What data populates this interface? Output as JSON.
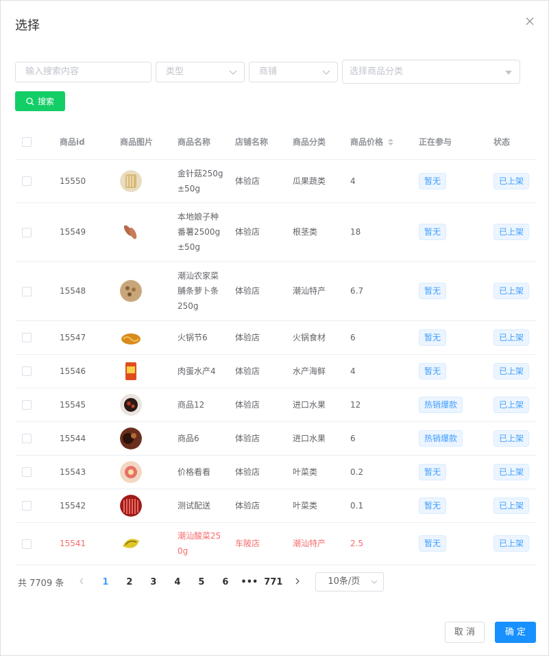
{
  "dialog": {
    "title": "选择"
  },
  "filters": {
    "search_placeholder": "输入搜索内容",
    "type_placeholder": "类型",
    "shop_placeholder": "商铺",
    "category_placeholder": "选择商品分类",
    "search_label": "搜索"
  },
  "table": {
    "headers": [
      "商品id",
      "商品图片",
      "商品名称",
      "店铺名称",
      "商品分类",
      "商品价格",
      "正在参与",
      "状态"
    ],
    "rows": [
      {
        "id": "15550",
        "name": "金针菇250g±50g",
        "shop": "体验店",
        "category": "瓜果蔬类",
        "price": "4",
        "participating": "暂无",
        "status": "已上架"
      },
      {
        "id": "15549",
        "name": "本地娘子种番薯2500g±50g",
        "shop": "体验店",
        "category": "根茎类",
        "price": "18",
        "participating": "暂无",
        "status": "已上架"
      },
      {
        "id": "15548",
        "name": "潮汕农家菜脯条萝卜条250g",
        "shop": "体验店",
        "category": "潮汕特产",
        "price": "6.7",
        "participating": "暂无",
        "status": "已上架"
      },
      {
        "id": "15547",
        "name": "火锅节6",
        "shop": "体验店",
        "category": "火锅食材",
        "price": "6",
        "participating": "暂无",
        "status": "已上架"
      },
      {
        "id": "15546",
        "name": "肉蛋水产4",
        "shop": "体验店",
        "category": "水产海鲜",
        "price": "4",
        "participating": "暂无",
        "status": "已上架"
      },
      {
        "id": "15545",
        "name": "商品12",
        "shop": "体验店",
        "category": "进口水果",
        "price": "12",
        "participating": "热销爆款",
        "status": "已上架"
      },
      {
        "id": "15544",
        "name": "商品6",
        "shop": "体验店",
        "category": "进口水果",
        "price": "6",
        "participating": "热销爆款",
        "status": "已上架"
      },
      {
        "id": "15543",
        "name": "价格看看",
        "shop": "体验店",
        "category": "叶菜类",
        "price": "0.2",
        "participating": "暂无",
        "status": "已上架"
      },
      {
        "id": "15542",
        "name": "测试配送",
        "shop": "体验店",
        "category": "叶菜类",
        "price": "0.1",
        "participating": "暂无",
        "status": "已上架"
      },
      {
        "id": "15541",
        "name": "潮汕酸菜250g",
        "shop": "车陂店",
        "category": "潮汕特产",
        "price": "2.5",
        "participating": "暂无",
        "status": "已上架"
      }
    ]
  },
  "pagination": {
    "total": "共 7709 条",
    "pages": [
      "1",
      "2",
      "3",
      "4",
      "5",
      "6",
      "•••",
      "771"
    ],
    "current": "1",
    "page_size": "10条/页"
  },
  "footer": {
    "cancel": "取 消",
    "ok": "确 定"
  },
  "colors": {
    "search_green": "#13ce66",
    "primary_blue": "#1890ff",
    "tag_blue": "#409eff",
    "highlight_red": "#f56c6c"
  }
}
